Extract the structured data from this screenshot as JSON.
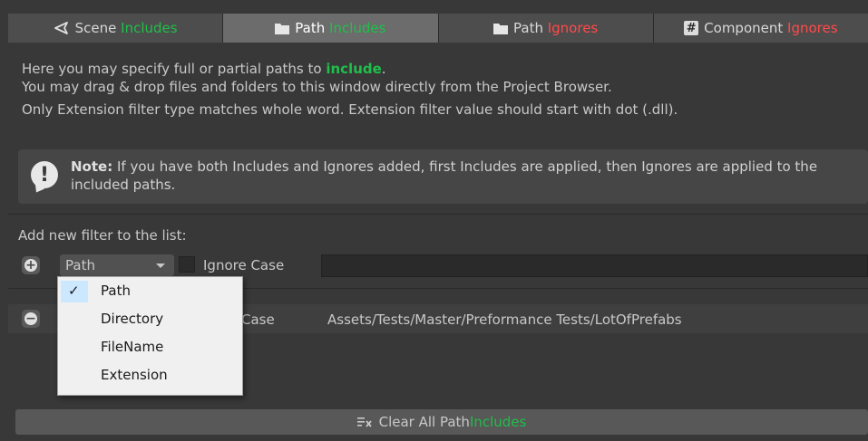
{
  "tabs": [
    {
      "label": "Scene",
      "accent": "Includes",
      "accent_color": "green",
      "icon": "scene-icon"
    },
    {
      "label": "Path",
      "accent": "Includes",
      "accent_color": "green",
      "icon": "folder-icon",
      "active": true
    },
    {
      "label": "Path",
      "accent": "Ignores",
      "accent_color": "red",
      "icon": "folder-icon"
    },
    {
      "label": "Component",
      "accent": "Ignores",
      "accent_color": "red",
      "icon": "hash-icon"
    }
  ],
  "description": {
    "line1_prefix": "Here you may specify full or partial paths to ",
    "line1_emph": "include",
    "line1_suffix": ".",
    "line2": "You may drag & drop files and folders to this window directly from the Project Browser.",
    "line3": "Only Extension filter type matches whole word. Extension filter value should start with dot (.dll)."
  },
  "note": {
    "title": "Note:",
    "text": " If you have both Includes and Ignores added, first Includes are applied, then Ignores are applied to the included paths."
  },
  "add_filter": {
    "label": "Add new filter to the list:",
    "type_value": "Path",
    "ignore_case_label": "Ignore Case",
    "value": ""
  },
  "filters": [
    {
      "ignore_case_label": "Case",
      "path": "Assets/Tests/Master/Preformance Tests/LotOfPrefabs"
    }
  ],
  "menu": {
    "items": [
      "Path",
      "Directory",
      "FileName",
      "Extension"
    ],
    "selected": "Path",
    "check_glyph": "✓"
  },
  "clear_button": {
    "prefix": "Clear All Path ",
    "accent": "Includes"
  },
  "colors": {
    "green": "#1fbf4a",
    "red": "#ff4a4a",
    "background": "#383838"
  }
}
